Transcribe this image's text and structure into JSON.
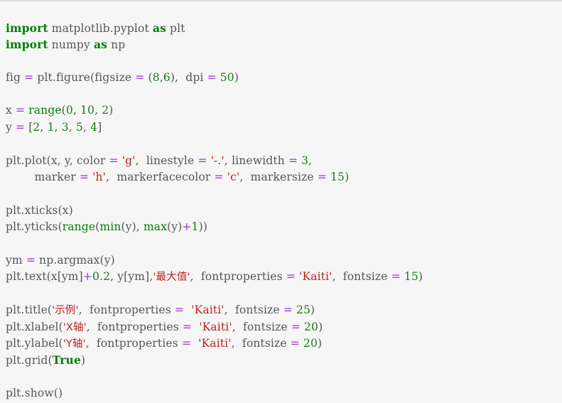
{
  "editor": {
    "kind": "code-snippet",
    "language": "python",
    "background_color": "#f6f6f6",
    "top_border_color": "#dcdcdc",
    "default_text_color": "#555555",
    "syntax_colors": {
      "keyword": "#007f00",
      "builtin": "#007f00",
      "number": "#1a7a1a",
      "string": "#bb2222",
      "operator": "#9933cc",
      "plain": "#555555"
    }
  },
  "code": {
    "lines": [
      {
        "id": "line-1",
        "tokens": [
          {
            "text": "import",
            "type": "keyword"
          },
          {
            "text": " matplotlib.pyplot ",
            "type": "plain"
          },
          {
            "text": "as",
            "type": "keyword"
          },
          {
            "text": " plt",
            "type": "plain"
          }
        ]
      },
      {
        "id": "line-2",
        "tokens": [
          {
            "text": "import",
            "type": "keyword"
          },
          {
            "text": " numpy ",
            "type": "plain"
          },
          {
            "text": "as",
            "type": "keyword"
          },
          {
            "text": " np",
            "type": "plain"
          }
        ]
      },
      {
        "id": "line-3",
        "tokens": []
      },
      {
        "id": "line-4",
        "tokens": [
          {
            "text": "fig ",
            "type": "plain"
          },
          {
            "text": "=",
            "type": "operator"
          },
          {
            "text": " plt.figure(figsize ",
            "type": "plain"
          },
          {
            "text": "=",
            "type": "operator"
          },
          {
            "text": " (",
            "type": "plain"
          },
          {
            "text": "8",
            "type": "number"
          },
          {
            "text": ",",
            "type": "plain"
          },
          {
            "text": "6",
            "type": "number"
          },
          {
            "text": "),  dpi ",
            "type": "plain"
          },
          {
            "text": "=",
            "type": "operator"
          },
          {
            "text": " ",
            "type": "plain"
          },
          {
            "text": "50",
            "type": "number"
          },
          {
            "text": ")",
            "type": "plain"
          }
        ]
      },
      {
        "id": "line-5",
        "tokens": []
      },
      {
        "id": "line-6",
        "tokens": [
          {
            "text": "x ",
            "type": "plain"
          },
          {
            "text": "=",
            "type": "operator"
          },
          {
            "text": " ",
            "type": "plain"
          },
          {
            "text": "range",
            "type": "builtin"
          },
          {
            "text": "(",
            "type": "plain"
          },
          {
            "text": "0",
            "type": "number"
          },
          {
            "text": ", ",
            "type": "plain"
          },
          {
            "text": "10",
            "type": "number"
          },
          {
            "text": ", ",
            "type": "plain"
          },
          {
            "text": "2",
            "type": "number"
          },
          {
            "text": ")",
            "type": "plain"
          }
        ]
      },
      {
        "id": "line-7",
        "tokens": [
          {
            "text": "y ",
            "type": "plain"
          },
          {
            "text": "=",
            "type": "operator"
          },
          {
            "text": " [",
            "type": "plain"
          },
          {
            "text": "2",
            "type": "number"
          },
          {
            "text": ", ",
            "type": "plain"
          },
          {
            "text": "1",
            "type": "number"
          },
          {
            "text": ", ",
            "type": "plain"
          },
          {
            "text": "3",
            "type": "number"
          },
          {
            "text": ", ",
            "type": "plain"
          },
          {
            "text": "5",
            "type": "number"
          },
          {
            "text": ", ",
            "type": "plain"
          },
          {
            "text": "4",
            "type": "number"
          },
          {
            "text": "]",
            "type": "plain"
          }
        ]
      },
      {
        "id": "line-8",
        "tokens": []
      },
      {
        "id": "line-9",
        "tokens": [
          {
            "text": "plt.plot(x, y, color ",
            "type": "plain"
          },
          {
            "text": "=",
            "type": "operator"
          },
          {
            "text": " ",
            "type": "plain"
          },
          {
            "text": "'g'",
            "type": "string"
          },
          {
            "text": ",  linestyle ",
            "type": "plain"
          },
          {
            "text": "=",
            "type": "operator"
          },
          {
            "text": " ",
            "type": "plain"
          },
          {
            "text": "'-.'",
            "type": "string"
          },
          {
            "text": ", linewidth ",
            "type": "plain"
          },
          {
            "text": "=",
            "type": "operator"
          },
          {
            "text": " ",
            "type": "plain"
          },
          {
            "text": "3",
            "type": "number"
          },
          {
            "text": ",",
            "type": "plain"
          }
        ]
      },
      {
        "id": "line-10",
        "tokens": [
          {
            "text": "        marker ",
            "type": "plain"
          },
          {
            "text": "=",
            "type": "operator"
          },
          {
            "text": " ",
            "type": "plain"
          },
          {
            "text": "'h'",
            "type": "string"
          },
          {
            "text": ",  markerfacecolor ",
            "type": "plain"
          },
          {
            "text": "=",
            "type": "operator"
          },
          {
            "text": " ",
            "type": "plain"
          },
          {
            "text": "'c'",
            "type": "string"
          },
          {
            "text": ",  markersize ",
            "type": "plain"
          },
          {
            "text": "=",
            "type": "operator"
          },
          {
            "text": " ",
            "type": "plain"
          },
          {
            "text": "15",
            "type": "number"
          },
          {
            "text": ")",
            "type": "plain"
          }
        ]
      },
      {
        "id": "line-11",
        "tokens": []
      },
      {
        "id": "line-12",
        "tokens": [
          {
            "text": "plt.xticks(x)",
            "type": "plain"
          }
        ]
      },
      {
        "id": "line-13",
        "tokens": [
          {
            "text": "plt.yticks(",
            "type": "plain"
          },
          {
            "text": "range",
            "type": "builtin"
          },
          {
            "text": "(",
            "type": "plain"
          },
          {
            "text": "min",
            "type": "builtin"
          },
          {
            "text": "(y), ",
            "type": "plain"
          },
          {
            "text": "max",
            "type": "builtin"
          },
          {
            "text": "(y)",
            "type": "plain"
          },
          {
            "text": "+",
            "type": "operator"
          },
          {
            "text": "1",
            "type": "number"
          },
          {
            "text": "))",
            "type": "plain"
          }
        ]
      },
      {
        "id": "line-14",
        "tokens": []
      },
      {
        "id": "line-15",
        "tokens": [
          {
            "text": "ym ",
            "type": "plain"
          },
          {
            "text": "=",
            "type": "operator"
          },
          {
            "text": " np.argmax(y)",
            "type": "plain"
          }
        ]
      },
      {
        "id": "line-16",
        "tokens": [
          {
            "text": "plt.text(x[ym]",
            "type": "plain"
          },
          {
            "text": "+",
            "type": "operator"
          },
          {
            "text": "0.2",
            "type": "number"
          },
          {
            "text": ", y[ym],",
            "type": "plain"
          },
          {
            "text": "'最大值'",
            "type": "string-cjk"
          },
          {
            "text": ",  fontproperties ",
            "type": "plain"
          },
          {
            "text": "=",
            "type": "operator"
          },
          {
            "text": " ",
            "type": "plain"
          },
          {
            "text": "'Kaiti'",
            "type": "string"
          },
          {
            "text": ",  fontsize ",
            "type": "plain"
          },
          {
            "text": "=",
            "type": "operator"
          },
          {
            "text": " ",
            "type": "plain"
          },
          {
            "text": "15",
            "type": "number"
          },
          {
            "text": ")",
            "type": "plain"
          }
        ]
      },
      {
        "id": "line-17",
        "tokens": []
      },
      {
        "id": "line-18",
        "tokens": [
          {
            "text": "plt.title(",
            "type": "plain"
          },
          {
            "text": "'示例'",
            "type": "string-cjk"
          },
          {
            "text": ",  fontproperties ",
            "type": "plain"
          },
          {
            "text": "=",
            "type": "operator"
          },
          {
            "text": "  ",
            "type": "plain"
          },
          {
            "text": "'Kaiti'",
            "type": "string"
          },
          {
            "text": ",  fontsize ",
            "type": "plain"
          },
          {
            "text": "=",
            "type": "operator"
          },
          {
            "text": " ",
            "type": "plain"
          },
          {
            "text": "25",
            "type": "number"
          },
          {
            "text": ")",
            "type": "plain"
          }
        ]
      },
      {
        "id": "line-19",
        "tokens": [
          {
            "text": "plt.xlabel(",
            "type": "plain"
          },
          {
            "text": "'X轴'",
            "type": "string-cjk"
          },
          {
            "text": ",  fontproperties ",
            "type": "plain"
          },
          {
            "text": "=",
            "type": "operator"
          },
          {
            "text": "  ",
            "type": "plain"
          },
          {
            "text": "'Kaiti'",
            "type": "string"
          },
          {
            "text": ",  fontsize ",
            "type": "plain"
          },
          {
            "text": "=",
            "type": "operator"
          },
          {
            "text": " ",
            "type": "plain"
          },
          {
            "text": "20",
            "type": "number"
          },
          {
            "text": ")",
            "type": "plain"
          }
        ]
      },
      {
        "id": "line-20",
        "tokens": [
          {
            "text": "plt.ylabel(",
            "type": "plain"
          },
          {
            "text": "'Y轴'",
            "type": "string-cjk"
          },
          {
            "text": ",  fontproperties ",
            "type": "plain"
          },
          {
            "text": "=",
            "type": "operator"
          },
          {
            "text": "  ",
            "type": "plain"
          },
          {
            "text": "'Kaiti'",
            "type": "string"
          },
          {
            "text": ",  fontsize ",
            "type": "plain"
          },
          {
            "text": "=",
            "type": "operator"
          },
          {
            "text": " ",
            "type": "plain"
          },
          {
            "text": "20",
            "type": "number"
          },
          {
            "text": ")",
            "type": "plain"
          }
        ]
      },
      {
        "id": "line-21",
        "tokens": [
          {
            "text": "plt.grid(",
            "type": "plain"
          },
          {
            "text": "True",
            "type": "keyword"
          },
          {
            "text": ")",
            "type": "plain"
          }
        ]
      },
      {
        "id": "line-22",
        "tokens": []
      },
      {
        "id": "line-23",
        "tokens": [
          {
            "text": "plt.show()",
            "type": "plain"
          }
        ]
      }
    ]
  }
}
